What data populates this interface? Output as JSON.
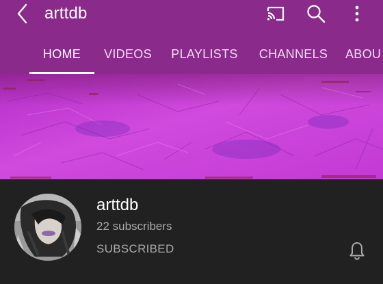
{
  "header": {
    "title": "arttdb",
    "background_color": "#8a2a8b",
    "icons": {
      "back": "back-arrow-icon",
      "cast": "cast-icon",
      "search": "search-icon",
      "more": "more-vert-icon"
    }
  },
  "tabs": [
    {
      "label": "HOME",
      "active": true
    },
    {
      "label": "VIDEOS",
      "active": false
    },
    {
      "label": "PLAYLISTS",
      "active": false
    },
    {
      "label": "CHANNELS",
      "active": false
    },
    {
      "label": "ABOU",
      "active": false
    }
  ],
  "banner": {
    "color": "#c43bd2"
  },
  "channel": {
    "name": "arttdb",
    "subscribers": "22 subscribers",
    "subscribe_status": "SUBSCRIBED",
    "notification_icon": "bell-icon"
  }
}
